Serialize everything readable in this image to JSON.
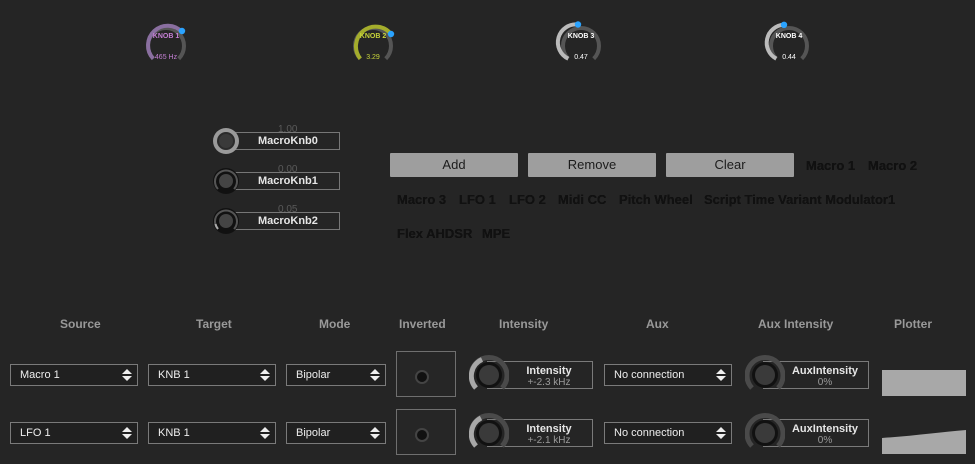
{
  "knobs": [
    {
      "label": "KNOB 1",
      "value": "465 Hz",
      "color": "#c47fd4",
      "level": 0.75
    },
    {
      "label": "KNOB 2",
      "value": "3.29",
      "color": "#c8d43a",
      "level": 0.72
    },
    {
      "label": "KNOB 3",
      "value": "0.47",
      "color": "#ffffff",
      "level": 0.47
    },
    {
      "label": "KNOB 4",
      "value": "0.44",
      "color": "#ffffff",
      "level": 0.44
    }
  ],
  "macro_knobs": [
    {
      "label": "MacroKnb0",
      "value": "1.00",
      "level": 1.0
    },
    {
      "label": "MacroKnb1",
      "value": "0.00",
      "level": 0.0
    },
    {
      "label": "MacroKnb2",
      "value": "0.05",
      "level": 0.05
    }
  ],
  "buttons": {
    "add": "Add",
    "remove": "Remove",
    "clear": "Clear"
  },
  "sources": [
    "Macro 1",
    "Macro 2",
    "Macro 3",
    "LFO 1",
    "LFO 2",
    "Midi CC",
    "Pitch Wheel",
    "Script Time Variant Modulator1",
    "Flex AHDSR",
    "MPE"
  ],
  "headers": {
    "source": "Source",
    "target": "Target",
    "mode": "Mode",
    "inverted": "Inverted",
    "intensity": "Intensity",
    "aux": "Aux",
    "aux_intensity": "Aux Intensity",
    "plotter": "Plotter"
  },
  "rows": [
    {
      "source": "Macro 1",
      "target": "KNB 1",
      "mode": "Bipolar",
      "intensity_label": "Intensity",
      "intensity_value": "+-2.3 kHz",
      "aux": "No connection",
      "aux_intensity_label": "AuxIntensity",
      "aux_intensity_value": "0%"
    },
    {
      "source": "LFO 1",
      "target": "KNB 1",
      "mode": "Bipolar",
      "intensity_label": "Intensity",
      "intensity_value": "+-2.1 kHz",
      "aux": "No connection",
      "aux_intensity_label": "AuxIntensity",
      "aux_intensity_value": "0%"
    }
  ],
  "colors": {
    "accent": "#2aa3ff",
    "background": "#252525",
    "button": "#9e9e9e"
  }
}
